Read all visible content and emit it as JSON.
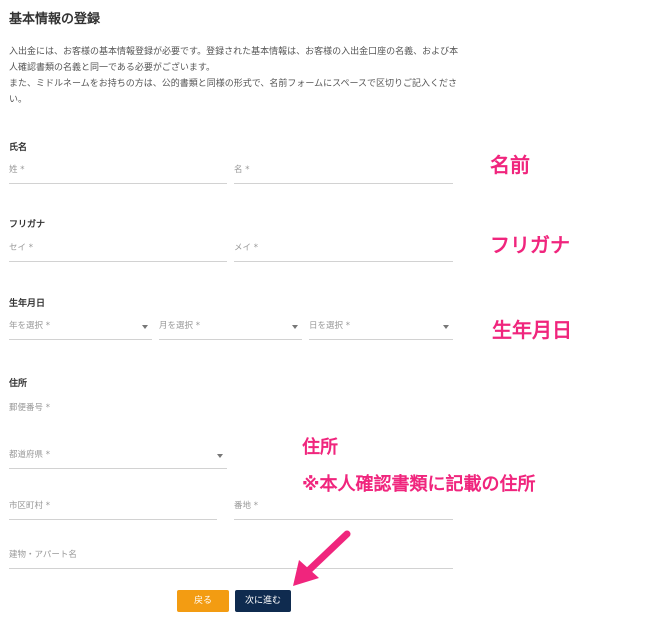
{
  "page": {
    "title": "基本情報の登録",
    "intro": "入出金には、お客様の基本情報登録が必要です。登録された基本情報は、お客様の入出金口座の名義、および本人確認書類の名義と同一である必要がございます。\nまた、ミドルネームをお持ちの方は、公的書類と同様の形式で、名前フォームにスペースで区切りご記入ください。"
  },
  "form": {
    "name": {
      "label": "氏名",
      "last_placeholder": "姓 *",
      "first_placeholder": "名 *"
    },
    "kana": {
      "label": "フリガナ",
      "last_placeholder": "セイ *",
      "first_placeholder": "メイ *"
    },
    "dob": {
      "label": "生年月日",
      "year_placeholder": "年を選択 *",
      "month_placeholder": "月を選択 *",
      "day_placeholder": "日を選択 *"
    },
    "address": {
      "label": "住所",
      "postal_placeholder": "郵便番号 *",
      "prefecture_placeholder": "都道府県 *",
      "city_placeholder": "市区町村 *",
      "street_placeholder": "番地 *",
      "building_placeholder": "建物・アパート名"
    }
  },
  "buttons": {
    "back": "戻る",
    "next": "次に進む"
  },
  "annotations": {
    "name": "名前",
    "kana": "フリガナ",
    "dob": "生年月日",
    "address_line1": "住所",
    "address_line2": "※本人確認書類に記載の住所"
  },
  "colors": {
    "accent_pink": "#f0257d",
    "back_button": "#f39c12",
    "next_button": "#0f2b4f"
  }
}
